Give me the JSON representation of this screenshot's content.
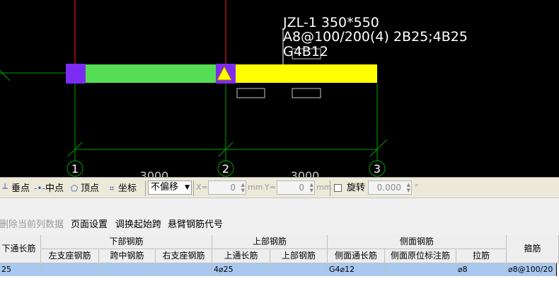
{
  "drawing": {
    "beam_label": "JZL-1 350*550",
    "stirrup_text": "A8@100/200(4) 2B25;4B25",
    "side_bar_text": "G4B12",
    "span_dim_1": "3000",
    "span_dim_2": "3000",
    "axis_1": "1",
    "axis_2": "2",
    "axis_3": "3",
    "colors": {
      "background": "#000000",
      "grid_line": "#ff0000",
      "axis_line": "#00a000",
      "beam_span_1": "#55dd55",
      "beam_span_2": "#ffff00",
      "support": "#7b2cf0"
    }
  },
  "snap_toolbar": {
    "perpendicular": "垂点",
    "perpendicular_icon": "perpendicular-icon",
    "midpoint": "中点",
    "midpoint_icon": "midpoint-icon",
    "vertex": "顶点",
    "vertex_icon": "vertex-icon",
    "coordinate": "坐标",
    "coordinate_icon": "coordinate-icon",
    "offset_select": "不偏移",
    "x_label": "X=",
    "x_value": "0",
    "x_unit": "mm",
    "y_label": "Y=",
    "y_value": "0",
    "y_unit": "mm",
    "rotate_label": "旋转",
    "rotate_value": "0.000",
    "rotate_unit": "°"
  },
  "menu": {
    "delete_column": "删除当前列数据",
    "page_setup": "页面设置",
    "swap_start_span": "调换起始跨",
    "cantilever_code": "悬臂钢筋代号"
  },
  "table": {
    "headers": {
      "bottom_through": "下通长筋",
      "bottom_rebar": "下部钢筋",
      "left_support": "左支座钢筋",
      "mid_span": "跨中钢筋",
      "right_support": "右支座钢筋",
      "top_rebar": "上部钢筋",
      "top_through": "上通长筋",
      "top_rebar_sub": "上部钢筋",
      "side_rebar": "侧面钢筋",
      "side_through": "侧面通长筋",
      "side_original": "侧面原位标注筋",
      "tie_bar": "拉筋",
      "stirrup": "箍筋"
    },
    "row": {
      "bottom_through": "25",
      "left_support": "",
      "mid_span": "",
      "right_support": "",
      "top_through": "4⌀25",
      "top_rebar_sub": "",
      "side_through": "G4⌀12",
      "side_original": "",
      "tie_bar": "⌀8",
      "stirrup": "⌀8@100/20"
    }
  }
}
